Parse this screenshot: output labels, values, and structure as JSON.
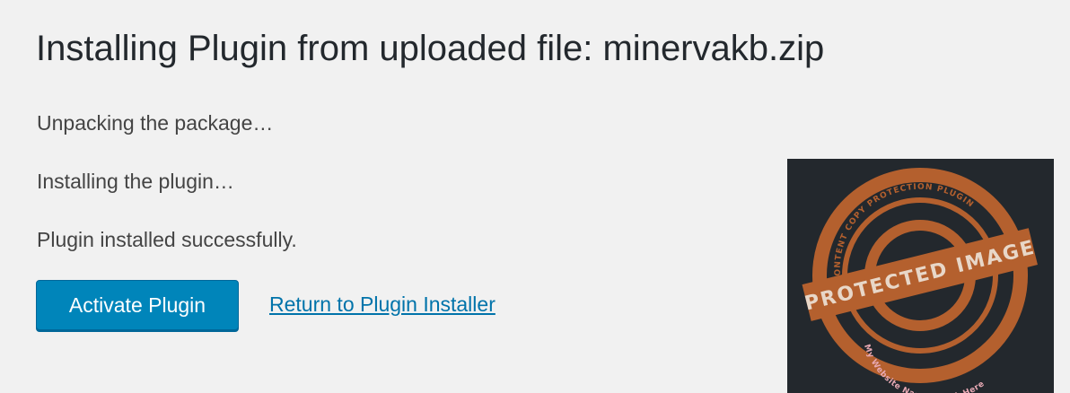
{
  "title": "Installing Plugin from uploaded file: minervakb.zip",
  "steps": [
    "Unpacking the package…",
    "Installing the plugin…",
    "Plugin installed successfully."
  ],
  "actions": {
    "activate_label": "Activate Plugin",
    "return_label": "Return to Plugin Installer"
  },
  "protected_image": {
    "stamp_text": "PROTECTED IMAGE",
    "arc_top_text": "CONTENT COPY PROTECTION PLUGIN",
    "arc_bottom_text": "My Website Name & URL Here",
    "stamp_color": "#b4602e",
    "background": "#23282d"
  },
  "colors": {
    "page_bg": "#f1f1f1",
    "primary_button": "#0085ba",
    "link": "#0073aa"
  }
}
